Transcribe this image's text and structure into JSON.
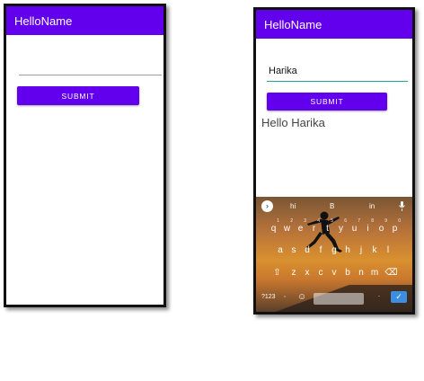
{
  "phone_left": {
    "app_title": "HelloName",
    "name_field_value": "",
    "submit_label": "SUBMIT"
  },
  "phone_right": {
    "app_title": "HelloName",
    "name_field_value": "Harika",
    "submit_label": "SUBMIT",
    "greeting": "Hello Harika",
    "keyboard": {
      "suggestions": [
        "hi",
        "B",
        "in"
      ],
      "row1": [
        "q",
        "w",
        "e",
        "r",
        "t",
        "y",
        "u",
        "i",
        "o",
        "p"
      ],
      "row1_numbers": [
        "1",
        "2",
        "3",
        "4",
        "5",
        "6",
        "7",
        "8",
        "9",
        "0"
      ],
      "row2": [
        "a",
        "s",
        "d",
        "f",
        "g",
        "h",
        "j",
        "k",
        "l"
      ],
      "row3": [
        "z",
        "x",
        "c",
        "v",
        "b",
        "n",
        "m"
      ],
      "symbols_key": "?123",
      "comma_key": ",",
      "period_key": "."
    }
  },
  "colors": {
    "app_bar": "#6200ee",
    "button": "#6200ee",
    "field_underline_focused": "#26a69a"
  }
}
